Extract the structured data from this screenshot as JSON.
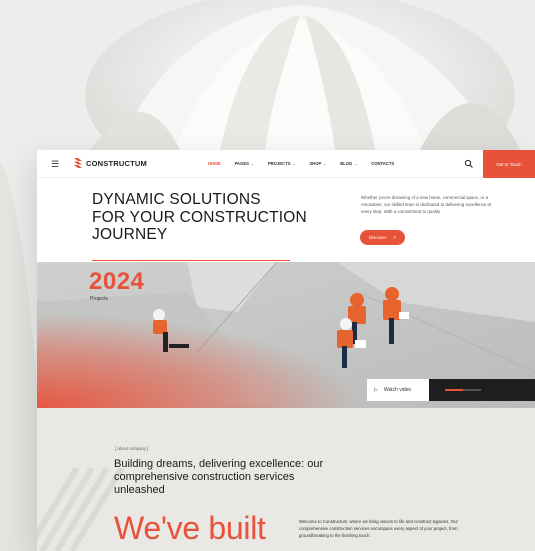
{
  "nav": {
    "menu_icon": "hamburger-icon",
    "logo_icon": "constructum-logo-icon",
    "logo": "CONSTRUCTUM",
    "items": [
      {
        "label": "HOME",
        "active": true,
        "dropdown": false
      },
      {
        "label": "PAGES",
        "active": false,
        "dropdown": true
      },
      {
        "label": "PROJECTS",
        "active": false,
        "dropdown": true
      },
      {
        "label": "SHOP",
        "active": false,
        "dropdown": true
      },
      {
        "label": "BLOG",
        "active": false,
        "dropdown": true
      },
      {
        "label": "CONTACTS",
        "active": false,
        "dropdown": false
      }
    ],
    "search_icon": "search-icon",
    "cta": "Get In Touch"
  },
  "hero": {
    "title_line1": "DYNAMIC SOLUTIONS",
    "title_line2": "FOR YOUR CONSTRUCTION",
    "title_line3": "JOURNEY",
    "desc": "Whether you're dreaming of a new home, commercial space, or a renovation, our skilled team is dedicated to delivering excellence at every step. With a commitment to quality",
    "discover": "Discover",
    "discover_icon": "arrow-up-right-icon"
  },
  "stats": {
    "year": "2024",
    "label": "Projects"
  },
  "video": {
    "label": "Watch video",
    "play_icon": "play-icon",
    "progress": 0.5
  },
  "about": {
    "label": "[ about company ]",
    "headline": "Building dreams, delivering excellence: our comprehensive construction services unleashed",
    "big_text": "We've built",
    "desc": "Welcome to Constructum, where we bring visions to life and construct legacies. Our comprehensive construction services encompass every aspect of your project, from groundbreaking to the finishing touch."
  },
  "colors": {
    "accent": "#e8523b",
    "dark": "#1e1e1e",
    "about_bg": "#e9e8e4"
  }
}
